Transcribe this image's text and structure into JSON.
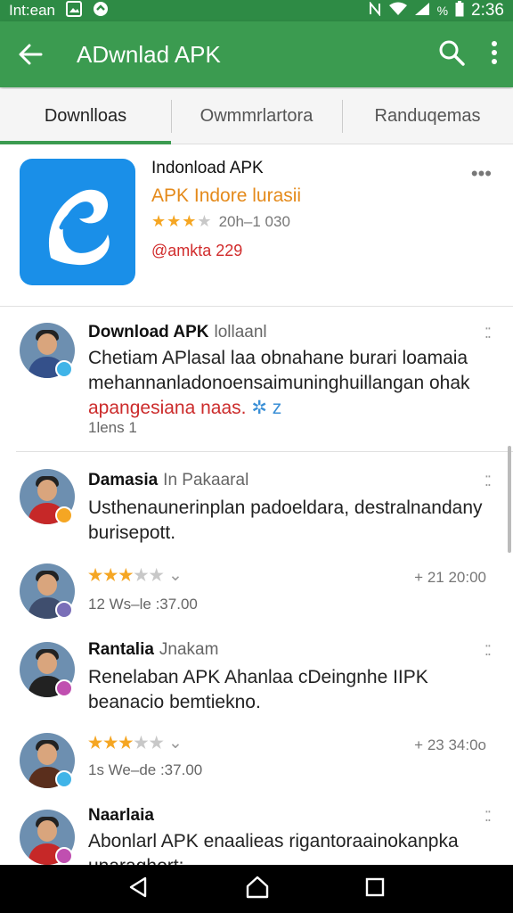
{
  "status_bar": {
    "left_text": "Int:ean",
    "time": "2:36",
    "battery": "%"
  },
  "app_bar": {
    "title": "ADwnlad APK"
  },
  "tabs": [
    "Downlloas",
    "Owmmrlartora",
    "Randuqemas"
  ],
  "app_card": {
    "name": "Indonload APK",
    "subtitle": "APK Indore lurasii",
    "rating_stars": 3,
    "rating_text": "20h–1 030",
    "developer": "@amkta 229",
    "icon_color": "#1a8fe8"
  },
  "reviews": [
    {
      "name": "Download APK",
      "tag": "lollaanl",
      "text": "Chetiam APlasal laa obnahane burari loamaia mehannanladonoensaimuninghuillangan ohak",
      "text_red": "apangesiana naas.",
      "meta": "1lens 1",
      "badge_color": "#40b4e8",
      "shirt_color": "#34508a"
    },
    {
      "name": "Damasia",
      "tag": "In Pakaaral",
      "text": "Usthenaunerinplan padoeldara, destralnandany burisepott.",
      "badge_color": "#f5a623",
      "shirt_color": "#c62828"
    },
    {
      "rating_stars": 3,
      "meta": "12 Ws–le :37.00",
      "time": "+ 21 20:00",
      "badge_color": "#7a6fb8",
      "shirt_color": "#3f4e6e"
    },
    {
      "name": "Rantalia",
      "tag": "Jnakam",
      "text": "Renelaban APK Ahanlaa cDeingnhe IIPK beanacio bemtiekno.",
      "badge_color": "#c04fb0",
      "shirt_color": "#222222"
    },
    {
      "rating_stars": 3,
      "meta": "1s We–de :37.00",
      "time": "+ 23 34:0o",
      "badge_color": "#40b4e8",
      "shirt_color": "#5a2e1c"
    },
    {
      "name": "Naarlaia",
      "text": "Abonlarl APK enaalieas rigantoraainokanpka unaraghort:",
      "badge_color": "#c04fb0",
      "shirt_color": "#c62828"
    }
  ]
}
